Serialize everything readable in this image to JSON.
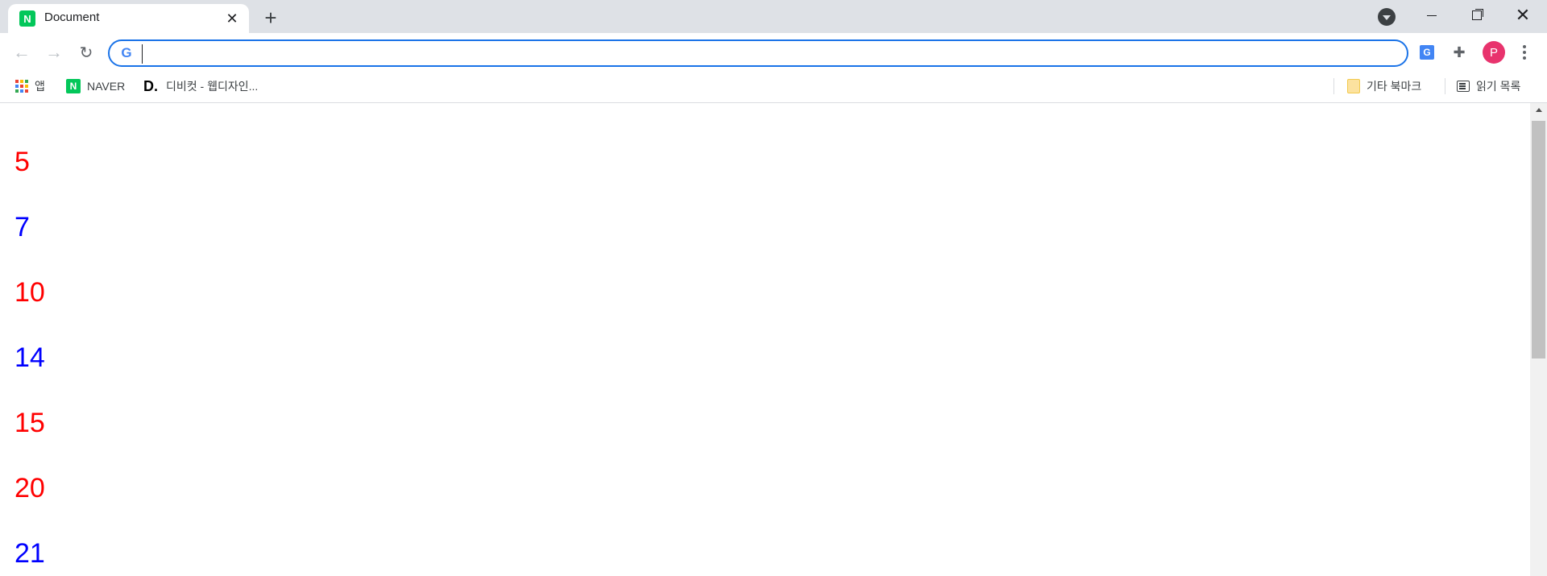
{
  "window": {
    "tab": {
      "title": "Document",
      "favicon": "N"
    },
    "accent": "#1a73e8"
  },
  "toolbar": {
    "address_value": "",
    "google_icon": "G",
    "avatar_initial": "P",
    "translate_glyph": "G"
  },
  "bookmarks": {
    "items": [
      {
        "label": "앱",
        "icon": "apps-grid-icon"
      },
      {
        "label": "NAVER",
        "icon": "naver-icon"
      },
      {
        "label": "디비컷 - 웹디자인...",
        "icon": "dbcut-icon"
      }
    ],
    "right": [
      {
        "label": "기타 북마크",
        "icon": "folder-icon"
      },
      {
        "label": "읽기 목록",
        "icon": "reading-list-icon"
      }
    ]
  },
  "page": {
    "numbers": [
      {
        "value": "5",
        "color": "#ff0000"
      },
      {
        "value": "7",
        "color": "#0000ff"
      },
      {
        "value": "10",
        "color": "#ff0000"
      },
      {
        "value": "14",
        "color": "#0000ff"
      },
      {
        "value": "15",
        "color": "#ff0000"
      },
      {
        "value": "20",
        "color": "#ff0000"
      },
      {
        "value": "21",
        "color": "#0000ff"
      }
    ]
  }
}
